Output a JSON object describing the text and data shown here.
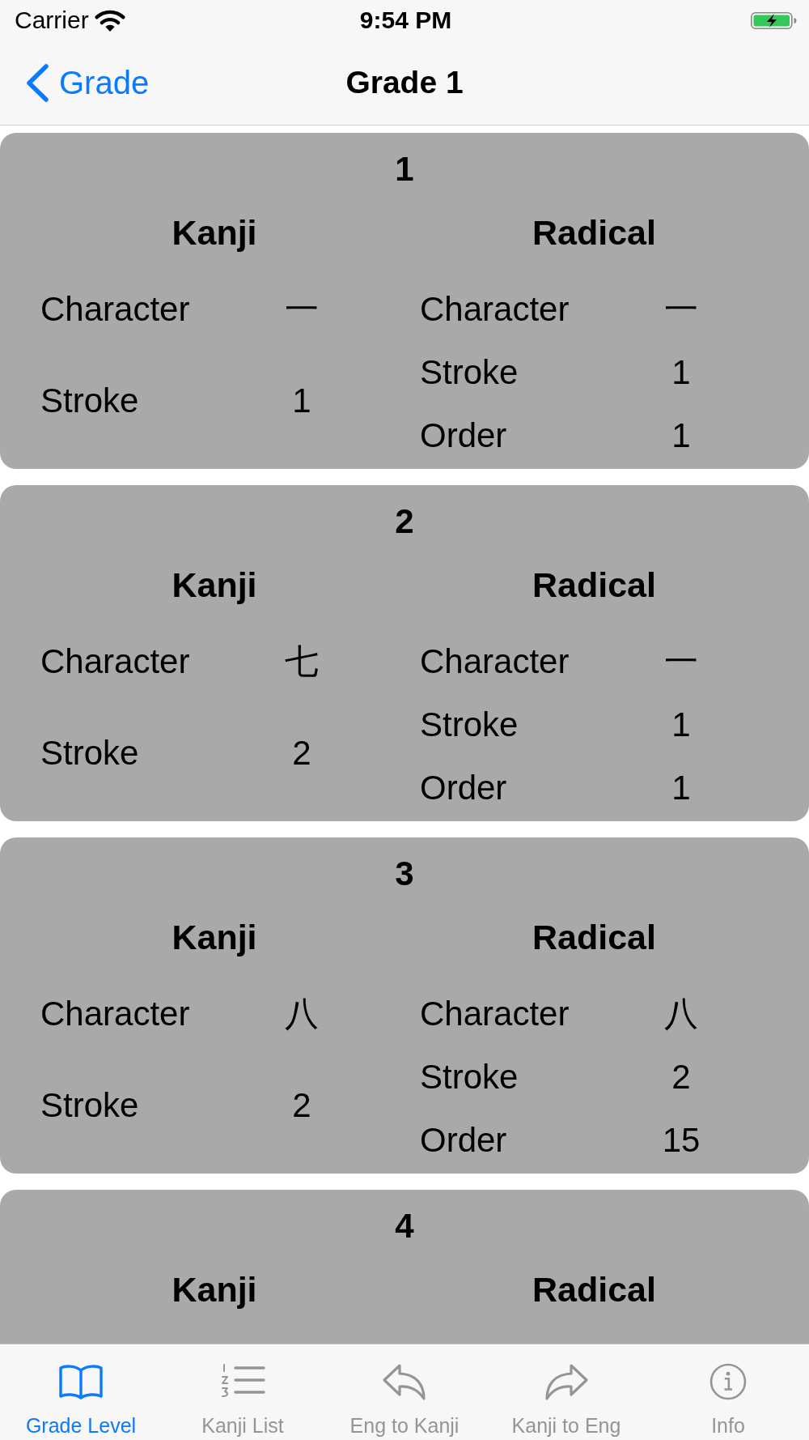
{
  "status_bar": {
    "carrier": "Carrier",
    "time": "9:54 PM"
  },
  "nav": {
    "back": "Grade",
    "title": "Grade 1"
  },
  "cards": [
    {
      "number": "1",
      "kanji": {
        "heading": "Kanji",
        "rows": [
          {
            "label": "Character",
            "value": "一"
          },
          {
            "label": "Stroke",
            "value": "1"
          }
        ]
      },
      "radical": {
        "heading": "Radical",
        "rows": [
          {
            "label": "Character",
            "value": "一"
          },
          {
            "label": "Stroke",
            "value": "1"
          },
          {
            "label": "Order",
            "value": "1"
          }
        ]
      }
    },
    {
      "number": "2",
      "kanji": {
        "heading": "Kanji",
        "rows": [
          {
            "label": "Character",
            "value": "七"
          },
          {
            "label": "Stroke",
            "value": "2"
          }
        ]
      },
      "radical": {
        "heading": "Radical",
        "rows": [
          {
            "label": "Character",
            "value": "一"
          },
          {
            "label": "Stroke",
            "value": "1"
          },
          {
            "label": "Order",
            "value": "1"
          }
        ]
      }
    },
    {
      "number": "3",
      "kanji": {
        "heading": "Kanji",
        "rows": [
          {
            "label": "Character",
            "value": "八"
          },
          {
            "label": "Stroke",
            "value": "2"
          }
        ]
      },
      "radical": {
        "heading": "Radical",
        "rows": [
          {
            "label": "Character",
            "value": "八"
          },
          {
            "label": "Stroke",
            "value": "2"
          },
          {
            "label": "Order",
            "value": "15"
          }
        ]
      }
    },
    {
      "number": "4",
      "kanji": {
        "heading": "Kanji"
      },
      "radical": {
        "heading": "Radical"
      }
    }
  ],
  "tabs": [
    {
      "label": "Grade Level",
      "selected": true
    },
    {
      "label": "Kanji List",
      "selected": false
    },
    {
      "label": "Eng to Kanji",
      "selected": false
    },
    {
      "label": "Kanji to Eng",
      "selected": false
    },
    {
      "label": "Info",
      "selected": false
    }
  ]
}
